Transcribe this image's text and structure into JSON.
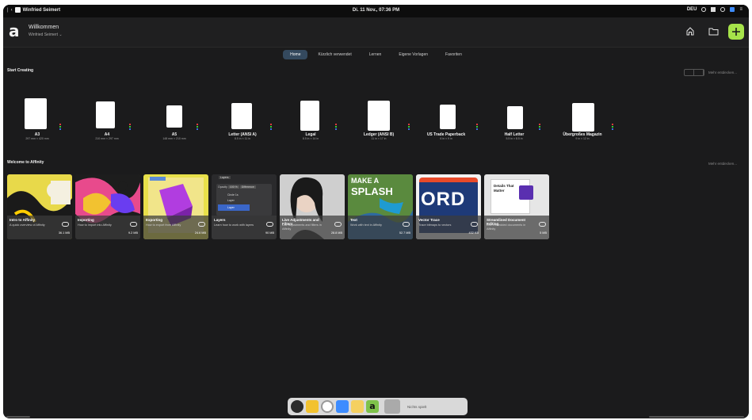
{
  "statusbar": {
    "app_name": "Winfried Seimert",
    "datetime": "Di. 11 Nov., 07:36 PM",
    "language": "DEU"
  },
  "header": {
    "welcome": "Willkommen",
    "user": "Winfried Seimert"
  },
  "tabs": [
    {
      "label": "Home",
      "active": true
    },
    {
      "label": "Kürzlich verwendet",
      "active": false
    },
    {
      "label": "Lernen",
      "active": false
    },
    {
      "label": "Eigene Vorlagen",
      "active": false
    },
    {
      "label": "Favoriten",
      "active": false
    }
  ],
  "start_creating": {
    "title": "Start Creating",
    "more": "Mehr entdecken...",
    "templates": [
      {
        "name": "A3",
        "size": "297 mm × 420 mm"
      },
      {
        "name": "A4",
        "size": "210 mm × 297 mm"
      },
      {
        "name": "A5",
        "size": "148 mm × 210 mm"
      },
      {
        "name": "Letter (ANSI A)",
        "size": "8.5 in × 11 in"
      },
      {
        "name": "Legal",
        "size": "8.5 in × 14 in"
      },
      {
        "name": "Ledger (ANSI B)",
        "size": "11 in × 17 in"
      },
      {
        "name": "US Trade Paperback",
        "size": "6 in × 9 in"
      },
      {
        "name": "Half Letter",
        "size": "5.5 in × 8.5 in"
      },
      {
        "name": "Übergroßes Magazin",
        "size": "9 in × 12 in"
      }
    ]
  },
  "welcome_section": {
    "title": "Welcome to Affinity",
    "more": "Mehr entdecken...",
    "tutorials": [
      {
        "title": "Intro to Affinity",
        "desc": "A quick overview of Affinity",
        "size": "36.1 MB"
      },
      {
        "title": "Importing",
        "desc": "How to import into Affinity",
        "size": "9.2 MB"
      },
      {
        "title": "Exporting",
        "desc": "How to export from Affinity",
        "size": "24.6 MB"
      },
      {
        "title": "Layers",
        "desc": "Learn how to work with layers",
        "size": "90 MB"
      },
      {
        "title": "Live Adjustments and Filters",
        "desc": "Use adjustments and filters in Affinity",
        "size": "28.8 MB"
      },
      {
        "title": "Text",
        "desc": "Work with text in Affinity",
        "size": "52.7 MB"
      },
      {
        "title": "Vector Trace",
        "desc": "Trace bitmaps to vectors",
        "size": "432 KB"
      },
      {
        "title": "Streamlined Document Editing",
        "desc": "Edit embedded documents in Affinity",
        "size": "5 MB"
      }
    ],
    "layers_popup": {
      "opacity_label": "Opacity",
      "opacity_value": "100 %",
      "blend": "Difference",
      "layer1": "Circle 1s",
      "layer2": "Layer",
      "layer3": "Layer",
      "tag": "Layers"
    },
    "text_art": {
      "line1": "MAKE A",
      "line2": "SPLASH"
    },
    "trace_art": "ORD",
    "editing_art": "Details That Matter"
  },
  "dock": {
    "label": "Nichts spielt"
  },
  "colors": {
    "accent_green": "#a6e34a",
    "active_tab": "#34495e",
    "background": "#1b1b1c"
  }
}
